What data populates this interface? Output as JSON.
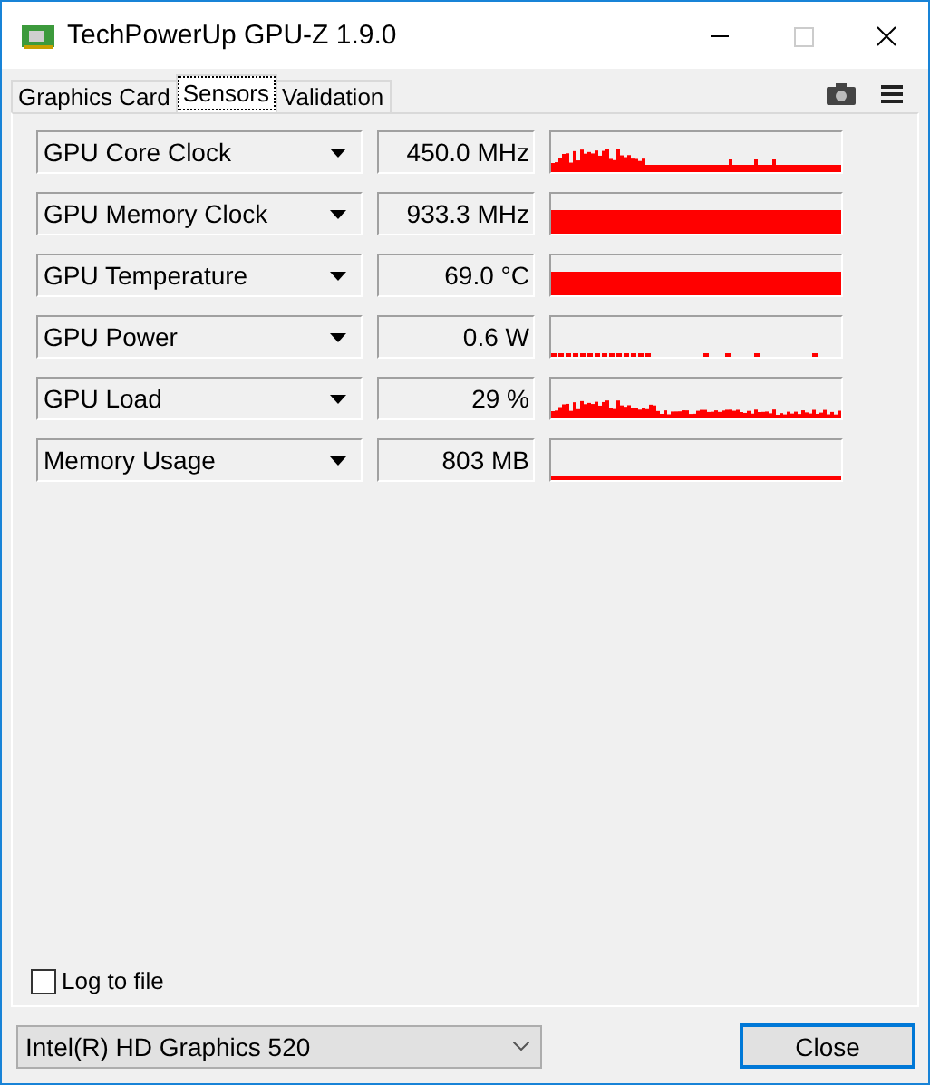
{
  "window": {
    "title": "TechPowerUp GPU-Z 1.9.0"
  },
  "tabs": [
    {
      "label": "Graphics Card",
      "selected": false
    },
    {
      "label": "Sensors",
      "selected": true
    },
    {
      "label": "Validation",
      "selected": false
    }
  ],
  "sensors": [
    {
      "name": "GPU Core Clock",
      "reading": "450.0 MHz",
      "kind": "spiky"
    },
    {
      "name": "GPU Memory Clock",
      "reading": "933.3 MHz",
      "kind": "solid"
    },
    {
      "name": "GPU Temperature",
      "reading": "69.0 °C",
      "kind": "solid"
    },
    {
      "name": "GPU Power",
      "reading": "0.6 W",
      "kind": "sparse"
    },
    {
      "name": "GPU Load",
      "reading": "29 %",
      "kind": "noisy"
    },
    {
      "name": "Memory Usage",
      "reading": "803 MB",
      "kind": "baseline"
    }
  ],
  "log_to_file": {
    "label": "Log to file",
    "checked": false
  },
  "device_select": {
    "value": "Intel(R) HD Graphics 520"
  },
  "close_button": {
    "label": "Close"
  }
}
